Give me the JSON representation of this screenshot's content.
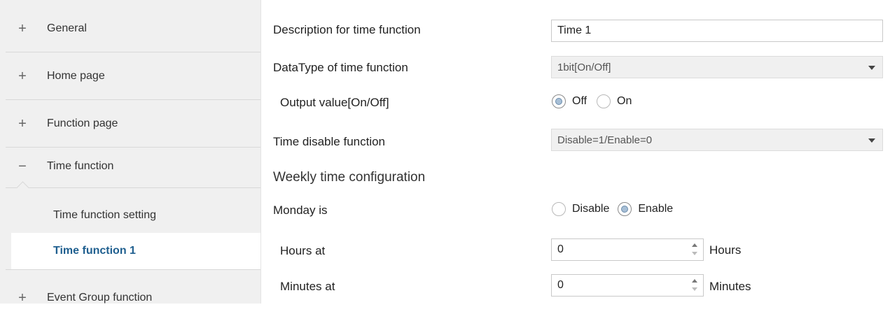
{
  "sidebar": {
    "items": [
      {
        "sign": "+",
        "label": "General"
      },
      {
        "sign": "+",
        "label": "Home page"
      },
      {
        "sign": "+",
        "label": "Function page"
      },
      {
        "sign": "−",
        "label": "Time function"
      }
    ],
    "subitems": [
      {
        "label": "Time function setting",
        "active": false
      },
      {
        "label": "Time function 1",
        "active": true
      }
    ],
    "bottom": {
      "sign": "+",
      "label": "Event Group function"
    }
  },
  "main": {
    "description": {
      "label": "Description for time function",
      "value": "Time 1"
    },
    "datatype": {
      "label": "DataType of time function",
      "value": "1bit[On/Off]"
    },
    "output": {
      "label": "Output value[On/Off]",
      "options": [
        "Off",
        "On"
      ],
      "selected": "Off"
    },
    "disable_func": {
      "label": "Time disable function",
      "value": "Disable=1/Enable=0"
    },
    "section_title": "Weekly time configuration",
    "monday": {
      "label": "Monday is",
      "options": [
        "Disable",
        "Enable"
      ],
      "selected": "Enable"
    },
    "hours": {
      "label": "Hours at",
      "value": "0",
      "unit": "Hours"
    },
    "minutes": {
      "label": "Minutes at",
      "value": "0",
      "unit": "Minutes"
    }
  }
}
